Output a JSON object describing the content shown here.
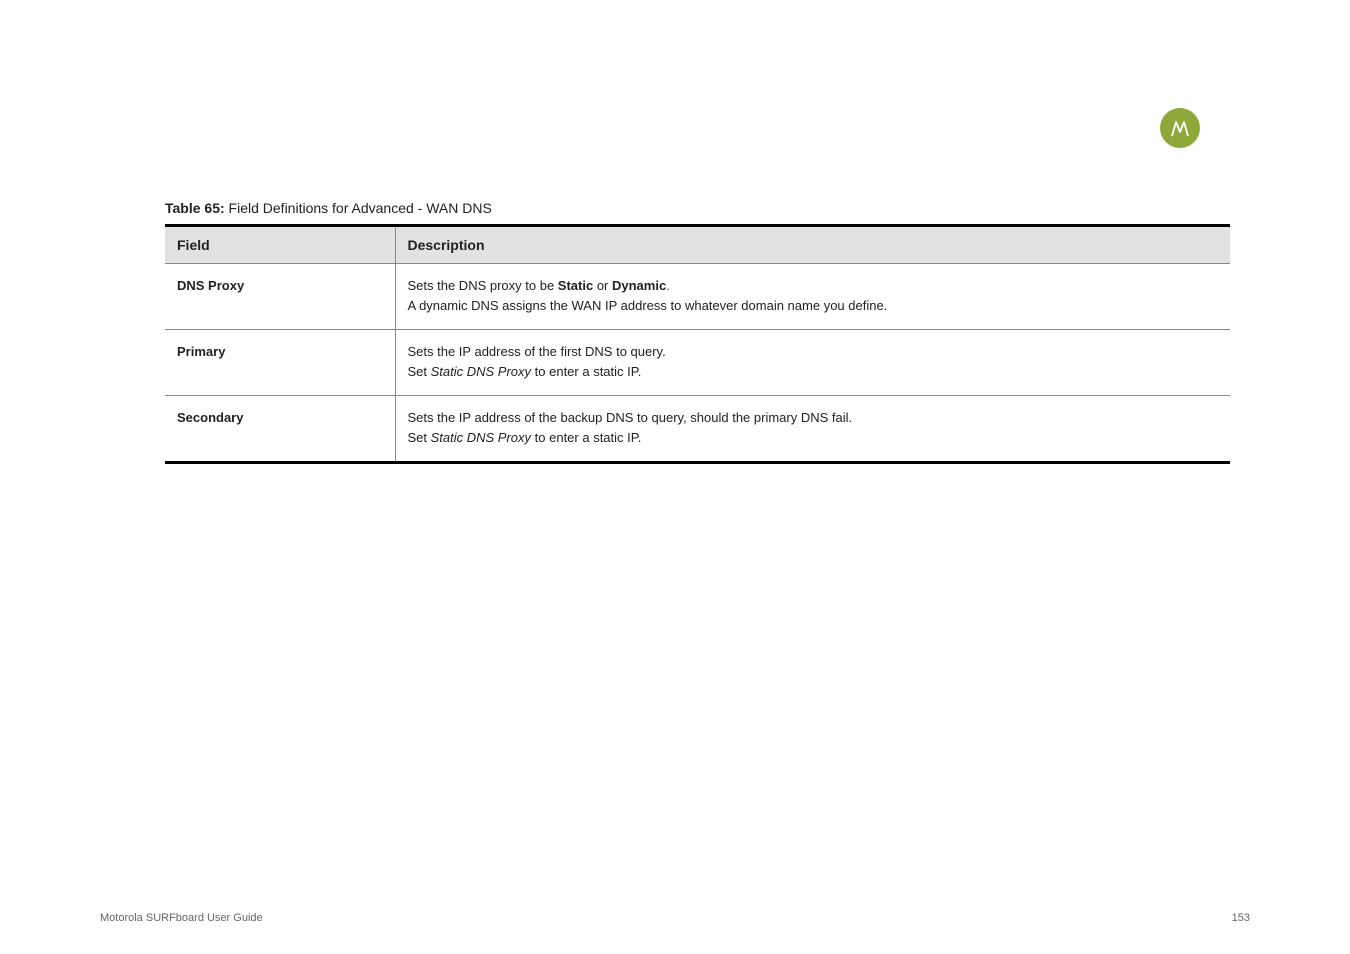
{
  "header": {
    "doc_left": "",
    "doc_right": ""
  },
  "logo": {
    "name": "motorola-logo"
  },
  "table": {
    "caption_prefix": "Table 65:",
    "caption_text": "Field Definitions for Advanced - WAN DNS",
    "columns": [
      "Field",
      "Description"
    ],
    "rows": [
      {
        "field": "DNS Proxy",
        "description_line1": "Sets the DNS proxy to be ",
        "description_bold1": "Static",
        "description_mid": " or ",
        "description_bold2": "Dynamic",
        "description_line2": "A dynamic DNS assigns the WAN IP address to whatever domain name you define."
      },
      {
        "field": "Primary",
        "description_line1": "Sets the IP address of the first DNS to query.",
        "description_line2_prefix": "Set ",
        "description_line2_italic": "Static DNS Proxy",
        "description_line2_suffix": " to enter a static IP."
      },
      {
        "field": "Secondary",
        "description_line1": "Sets the IP address of the backup DNS to query, should the primary DNS fail.",
        "description_line2_prefix": "Set ",
        "description_line2_italic": "Static DNS Proxy",
        "description_line2_suffix": " to enter a static IP."
      }
    ]
  },
  "footer": {
    "left": "Motorola SURFboard User Guide",
    "right": "153"
  }
}
